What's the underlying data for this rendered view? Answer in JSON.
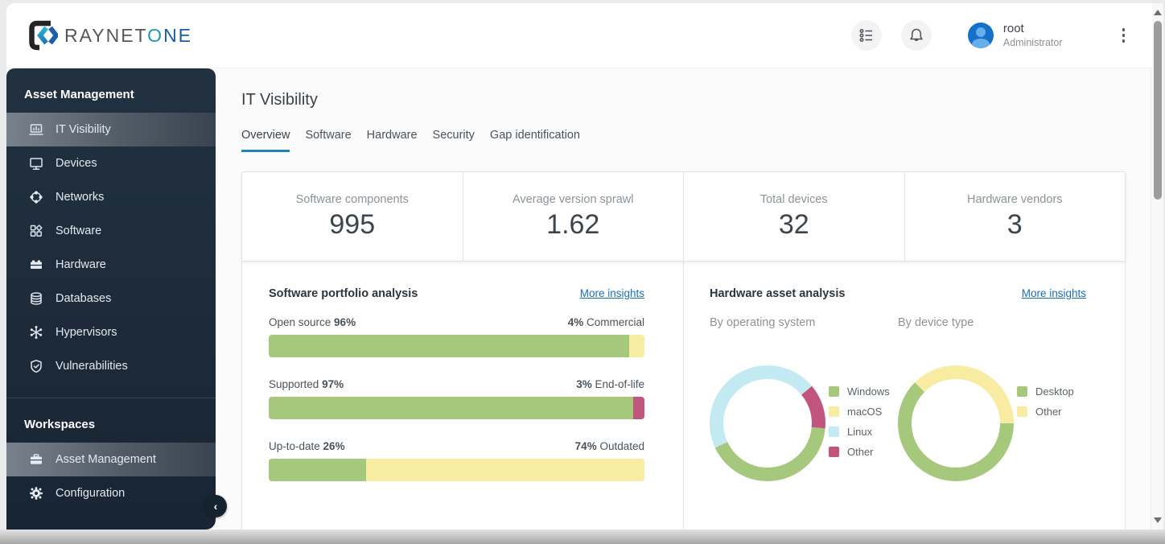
{
  "palette": {
    "green": "#a6c87c",
    "yellow": "#f7eca1",
    "pink": "#c2557e",
    "cyan": "#c3eaf2",
    "navy": "#1d2b3b",
    "link": "#1a6fba",
    "accent": "#1e87b5"
  },
  "header": {
    "logo": {
      "part1": "RAYNET",
      "part2": "O",
      "part3": "NE"
    },
    "user": {
      "name": "root",
      "role": "Administrator"
    }
  },
  "sidebar": {
    "section1_title": "Asset Management",
    "items": [
      {
        "label": "IT Visibility",
        "icon": "laptop-chart-icon",
        "active": true
      },
      {
        "label": "Devices",
        "icon": "monitor-icon",
        "active": false
      },
      {
        "label": "Networks",
        "icon": "network-icon",
        "active": false
      },
      {
        "label": "Software",
        "icon": "software-grid-icon",
        "active": false
      },
      {
        "label": "Hardware",
        "icon": "brick-icon",
        "active": false
      },
      {
        "label": "Databases",
        "icon": "database-icon",
        "active": false
      },
      {
        "label": "Hypervisors",
        "icon": "hypervisor-icon",
        "active": false
      },
      {
        "label": "Vulnerabilities",
        "icon": "shield-check-icon",
        "active": false
      }
    ],
    "section2_title": "Workspaces",
    "workspaces": [
      {
        "label": "Asset Management",
        "icon": "briefcase-icon",
        "active": true
      },
      {
        "label": "Configuration",
        "icon": "gear-icon",
        "active": false
      }
    ]
  },
  "main": {
    "title": "IT Visibility",
    "tabs": [
      {
        "label": "Overview",
        "active": true
      },
      {
        "label": "Software",
        "active": false
      },
      {
        "label": "Hardware",
        "active": false
      },
      {
        "label": "Security",
        "active": false
      },
      {
        "label": "Gap identification",
        "active": false
      }
    ],
    "stats": [
      {
        "label": "Software components",
        "value": "995"
      },
      {
        "label": "Average version sprawl",
        "value": "1.62"
      },
      {
        "label": "Total devices",
        "value": "32"
      },
      {
        "label": "Hardware vendors",
        "value": "3"
      }
    ],
    "software_portfolio": {
      "title": "Software portfolio analysis",
      "link": "More insights",
      "bars": [
        {
          "left_label": "Open source ",
          "left_pct": "96%",
          "right_pct": "4%",
          "right_label": " Commercial",
          "segments": [
            {
              "color": "green",
              "pct": 96
            },
            {
              "color": "yellow",
              "pct": 4
            }
          ]
        },
        {
          "left_label": "Supported ",
          "left_pct": "97%",
          "right_pct": "3%",
          "right_label": " End-of-life",
          "segments": [
            {
              "color": "green",
              "pct": 97
            },
            {
              "color": "pink",
              "pct": 3
            }
          ]
        },
        {
          "left_label": "Up-to-date ",
          "left_pct": "26%",
          "right_pct": "74%",
          "right_label": " Outdated",
          "segments": [
            {
              "color": "green",
              "pct": 26
            },
            {
              "color": "yellow",
              "pct": 74
            }
          ]
        }
      ]
    },
    "hardware_analysis": {
      "title": "Hardware asset analysis",
      "link": "More insights",
      "donuts": [
        {
          "subtitle": "By operating system",
          "segments": [
            {
              "color": "cyan",
              "from": 0,
              "to": 50
            },
            {
              "color": "pink",
              "from": 50,
              "to": 95
            },
            {
              "color": "green",
              "from": 95,
              "to": 245
            },
            {
              "color": "cyan",
              "from": 245,
              "to": 360
            }
          ],
          "legend": [
            {
              "label": "Windows",
              "color": "green"
            },
            {
              "label": "macOS",
              "color": "yellow"
            },
            {
              "label": "Linux",
              "color": "cyan"
            },
            {
              "label": "Other",
              "color": "pink"
            }
          ]
        },
        {
          "subtitle": "By device type",
          "segments": [
            {
              "color": "yellow",
              "from": 0,
              "to": 90
            },
            {
              "color": "green",
              "from": 90,
              "to": 315
            },
            {
              "color": "yellow",
              "from": 315,
              "to": 360
            }
          ],
          "legend": [
            {
              "label": "Desktop",
              "color": "green"
            },
            {
              "label": "Other",
              "color": "yellow"
            }
          ]
        }
      ]
    }
  },
  "chart_data": [
    {
      "type": "bar",
      "title": "Software portfolio analysis",
      "categories": [
        "Open source vs Commercial",
        "Supported vs End-of-life",
        "Up-to-date vs Outdated"
      ],
      "series": [
        {
          "name": "left",
          "values": [
            96,
            97,
            26
          ]
        },
        {
          "name": "right",
          "values": [
            4,
            3,
            74
          ]
        }
      ]
    },
    {
      "type": "pie",
      "title": "By operating system",
      "categories": [
        "Windows",
        "macOS",
        "Linux",
        "Other"
      ],
      "values": [
        42,
        0,
        46,
        12
      ]
    },
    {
      "type": "pie",
      "title": "By device type",
      "categories": [
        "Desktop",
        "Other"
      ],
      "values": [
        62,
        38
      ]
    }
  ]
}
